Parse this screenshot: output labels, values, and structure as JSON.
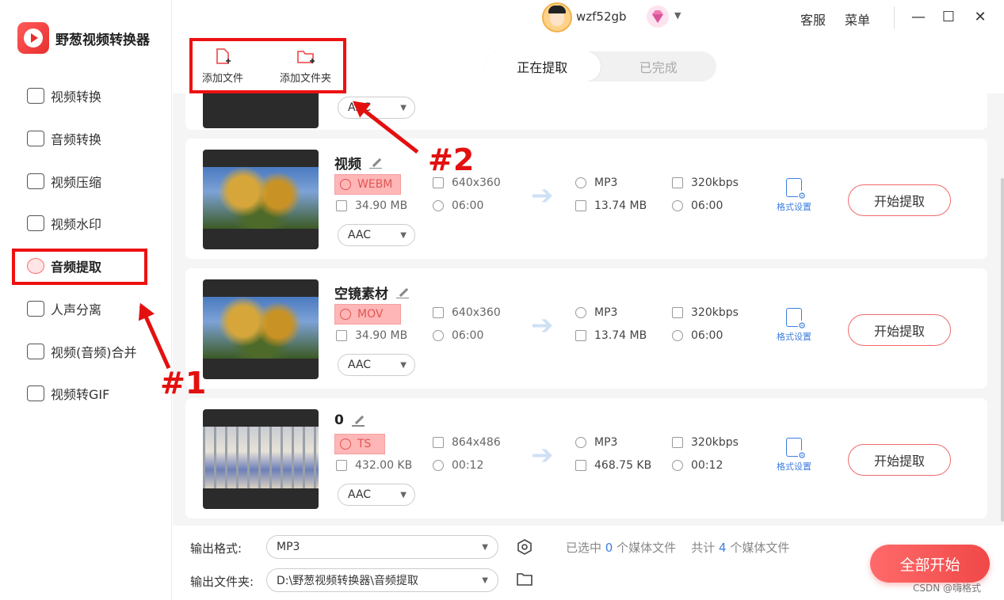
{
  "app": {
    "name": "野葱视频转换器"
  },
  "header": {
    "username": "wzf52gb",
    "links": [
      "客服",
      "菜单"
    ]
  },
  "sidebar": {
    "items": [
      {
        "label": "视频转换",
        "icon": "video-convert-icon"
      },
      {
        "label": "音频转换",
        "icon": "audio-convert-icon"
      },
      {
        "label": "视频压缩",
        "icon": "video-compress-icon"
      },
      {
        "label": "视频水印",
        "icon": "watermark-icon"
      },
      {
        "label": "音频提取",
        "icon": "audio-extract-icon",
        "active": true
      },
      {
        "label": "人声分离",
        "icon": "voice-separate-icon"
      },
      {
        "label": "视频(音频)合并",
        "icon": "merge-icon"
      },
      {
        "label": "视频转GIF",
        "icon": "gif-icon"
      }
    ]
  },
  "toolbar": {
    "add_file": "添加文件",
    "add_folder": "添加文件夹"
  },
  "tabs": {
    "extracting": "正在提取",
    "done": "已完成"
  },
  "files": [
    {
      "name": "视频",
      "src_format": "WEBM",
      "resolution": "640x360",
      "size": "34.90 MB",
      "duration": "06:00",
      "audio_codec": "AAC",
      "out_format": "MP3",
      "out_bitrate": "320kbps",
      "out_size": "13.74 MB",
      "out_duration": "06:00",
      "settings_label": "格式设置",
      "action_label": "开始提取"
    },
    {
      "name": "空镜素材",
      "src_format": "MOV",
      "resolution": "640x360",
      "size": "34.90 MB",
      "duration": "06:00",
      "audio_codec": "AAC",
      "out_format": "MP3",
      "out_bitrate": "320kbps",
      "out_size": "13.74 MB",
      "out_duration": "06:00",
      "settings_label": "格式设置",
      "action_label": "开始提取"
    },
    {
      "name": "0",
      "src_format": "TS",
      "resolution": "864x486",
      "size": "432.00 KB",
      "duration": "00:12",
      "audio_codec": "AAC",
      "out_format": "MP3",
      "out_bitrate": "320kbps",
      "out_size": "468.75 KB",
      "out_duration": "00:12",
      "settings_label": "格式设置",
      "action_label": "开始提取"
    }
  ],
  "partial_top_card": {
    "audio_codec": "AAC"
  },
  "bottom": {
    "output_format_label": "输出格式:",
    "output_format_value": "MP3",
    "output_folder_label": "输出文件夹:",
    "output_folder_value": "D:\\野葱视频转换器\\音频提取",
    "selected_prefix": "已选中",
    "selected_count": "0",
    "selected_suffix": "个媒体文件",
    "total_prefix": "共计",
    "total_count": "4",
    "total_suffix": "个媒体文件",
    "start_all": "全部开始"
  },
  "annotations": {
    "mark1": "#1",
    "mark2": "#2"
  },
  "watermark": "CSDN @嗨格式",
  "colors": {
    "accent": "#f04848",
    "link_blue": "#3c7ee0",
    "annotation_red": "#e31010"
  }
}
